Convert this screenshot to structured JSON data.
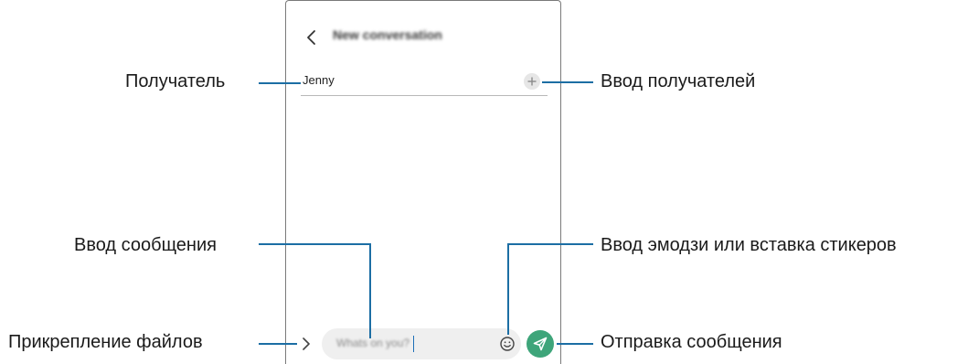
{
  "screen": {
    "title": "New conversation",
    "recipient_value": "Jenny",
    "message_placeholder": "Whats on you?"
  },
  "icons": {
    "back": "chevron-left-icon",
    "add_recipient": "plus-icon",
    "attach": "chevron-right-icon",
    "emoji": "smiley-icon",
    "send": "paper-plane-icon"
  },
  "colors": {
    "callout_line": "#1c6ea4",
    "send_button": "#3ea57a",
    "screen_border": "#7a7a7a"
  },
  "callouts": {
    "recipient": "Получатель",
    "enter_recipients": "Ввод получателей",
    "enter_message": "Ввод сообщения",
    "emoji_stickers": "Ввод эмодзи или вставка стикеров",
    "attach_files": "Прикрепление файлов",
    "send_message": "Отправка сообщения"
  }
}
